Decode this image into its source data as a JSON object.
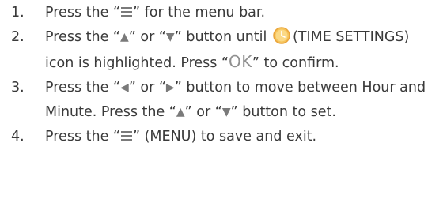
{
  "steps": [
    {
      "num": "1.",
      "t1": "Press the “",
      "t2": "” for the menu bar."
    },
    {
      "num": "2.",
      "t1": "Press the “",
      "t2": "” or “",
      "t3": "” button until",
      "t4": "(TIME SETTINGS) icon is highlighted. Press “",
      "ok": "OK",
      "t5": "” to confirm."
    },
    {
      "num": "3.",
      "t1": "Press the “",
      "t2": "” or “",
      "t3": "” button to move between Hour and Minute. Press the “",
      "t4": "” or “",
      "t5": "” button to set."
    },
    {
      "num": "4.",
      "t1": "Press the “",
      "t2": "” (MENU) to save and exit."
    }
  ],
  "icons": {
    "menu": "menu-icon",
    "up": "up-arrow-icon",
    "down": "down-arrow-icon",
    "left": "left-arrow-icon",
    "right": "right-arrow-icon",
    "time_settings": "clock-icon"
  },
  "colors": {
    "text": "#3a3a3a",
    "glyph": "#7a7a7a",
    "ok": "#909090",
    "clock_fill": "#f5c35a",
    "clock_ring": "#eaa43a"
  }
}
